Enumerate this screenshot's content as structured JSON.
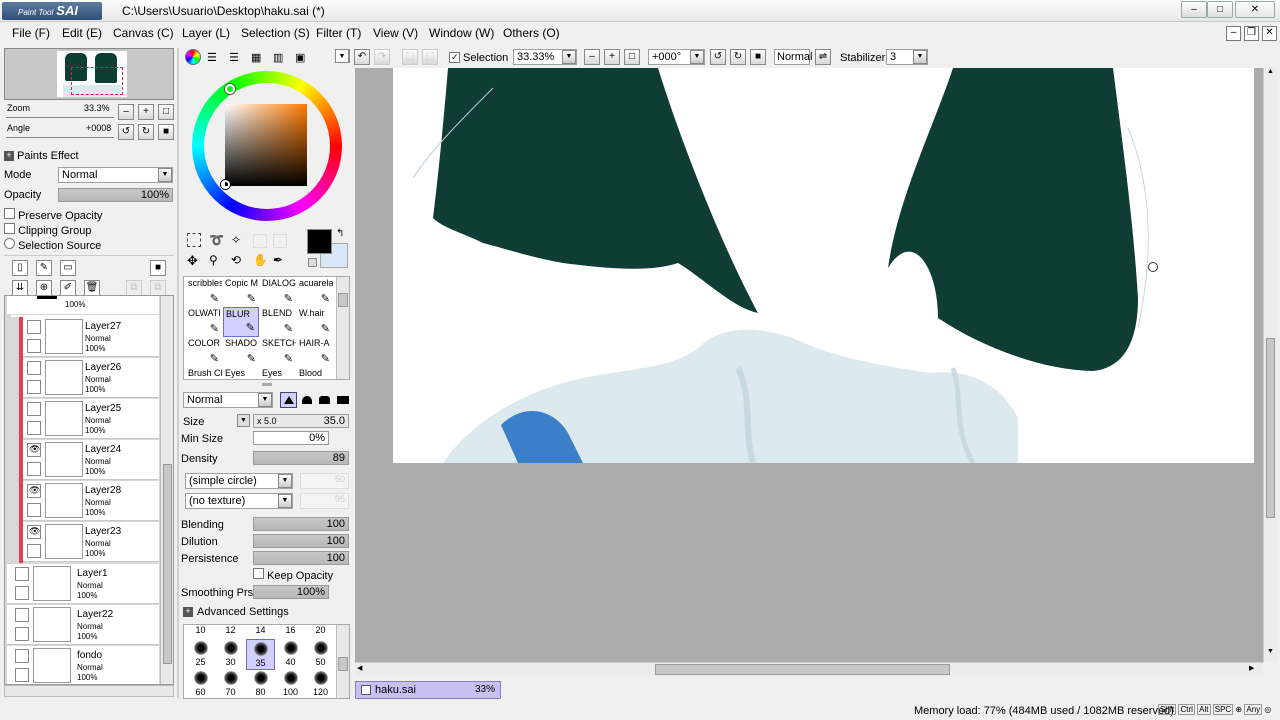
{
  "window": {
    "app_name": "PaintTool SAI",
    "title": "C:\\Users\\Usuario\\Desktop\\haku.sai (*)"
  },
  "menu": [
    "File (F)",
    "Edit (E)",
    "Canvas (C)",
    "Layer (L)",
    "Selection (S)",
    "Filter (T)",
    "View (V)",
    "Window (W)",
    "Others (O)"
  ],
  "navigator": {
    "zoom_label": "Zoom",
    "zoom_value": "33.3%",
    "angle_label": "Angle",
    "angle_value": "+0008"
  },
  "layer_props": {
    "paints_effect": "Paints Effect",
    "mode_label": "Mode",
    "mode_value": "Normal",
    "opacity_label": "Opacity",
    "opacity_value": "100%",
    "preserve_opacity": "Preserve Opacity",
    "clipping_group": "Clipping Group",
    "selection_source": "Selection Source"
  },
  "layers": [
    {
      "name": "Layer27",
      "mode": "Normal",
      "opacity": "100%",
      "visible": false
    },
    {
      "name": "Layer26",
      "mode": "Normal",
      "opacity": "100%",
      "visible": false
    },
    {
      "name": "Layer25",
      "mode": "Normal",
      "opacity": "100%",
      "visible": false
    },
    {
      "name": "Layer24",
      "mode": "Normal",
      "opacity": "100%",
      "visible": true
    },
    {
      "name": "Layer28",
      "mode": "Normal",
      "opacity": "100%",
      "visible": true
    },
    {
      "name": "Layer23",
      "mode": "Normal",
      "opacity": "100%",
      "visible": true
    },
    {
      "name": "Layer1",
      "mode": "Normal",
      "opacity": "100%",
      "visible": false
    },
    {
      "name": "Layer22",
      "mode": "Normal",
      "opacity": "100%",
      "visible": false
    },
    {
      "name": "fondo",
      "mode": "Normal",
      "opacity": "100%",
      "visible": false
    }
  ],
  "top_layer_partial_opacity": "100%",
  "brushes": [
    [
      "scribbles",
      "Copic M",
      "DIALOG",
      "acuarela"
    ],
    [
      "OLWATI",
      "BLUR",
      "BLEND",
      "W.hair"
    ],
    [
      "COLOR",
      "SHADO",
      "SKETCH",
      "HAIR-A"
    ],
    [
      "Brush Cl",
      "Eyes",
      "Eyes",
      "Blood"
    ]
  ],
  "brush_settings": {
    "blend_mode": "Normal",
    "size_label": "Size",
    "size_mult": "x 5.0",
    "size_value": "35.0",
    "min_size_label": "Min Size",
    "min_size_value": "0%",
    "density_label": "Density",
    "density_value": "89",
    "shape": "(simple circle)",
    "shape_value": "50",
    "texture": "(no texture)",
    "texture_value": "95",
    "blending_label": "Blending",
    "blending_value": "100",
    "dilution_label": "Dilution",
    "dilution_value": "100",
    "persistence_label": "Persistence",
    "persistence_value": "100",
    "keep_opacity": "Keep Opacity",
    "smoothing_label": "Smoothing Prs",
    "smoothing_value": "100%",
    "advanced": "Advanced Settings"
  },
  "brush_sizes": [
    [
      "10",
      "12",
      "14",
      "16",
      "20"
    ],
    [
      "25",
      "30",
      "35",
      "40",
      "50"
    ],
    [
      "60",
      "70",
      "80",
      "100",
      "120"
    ]
  ],
  "toolbar": {
    "selection_label": "Selection",
    "zoom": "33.33%",
    "rotation": "+000°",
    "mode": "Normal",
    "stabilizer_label": "Stabilizer",
    "stabilizer_value": "3"
  },
  "doc_tab": {
    "name": "haku.sai",
    "zoom": "33%"
  },
  "status": {
    "memory": "Memory load: 77% (484MB used / 1082MB reserved)",
    "keys": [
      "Shft",
      "Ctrl",
      "Alt",
      "SPC",
      "Any"
    ]
  },
  "colors": {
    "hair": "#0f3d35",
    "ribbon": "#3b7fc8",
    "shirt": "#dce9ee",
    "workspace": "#ababab",
    "selected_tab": "#c8c0f0"
  }
}
